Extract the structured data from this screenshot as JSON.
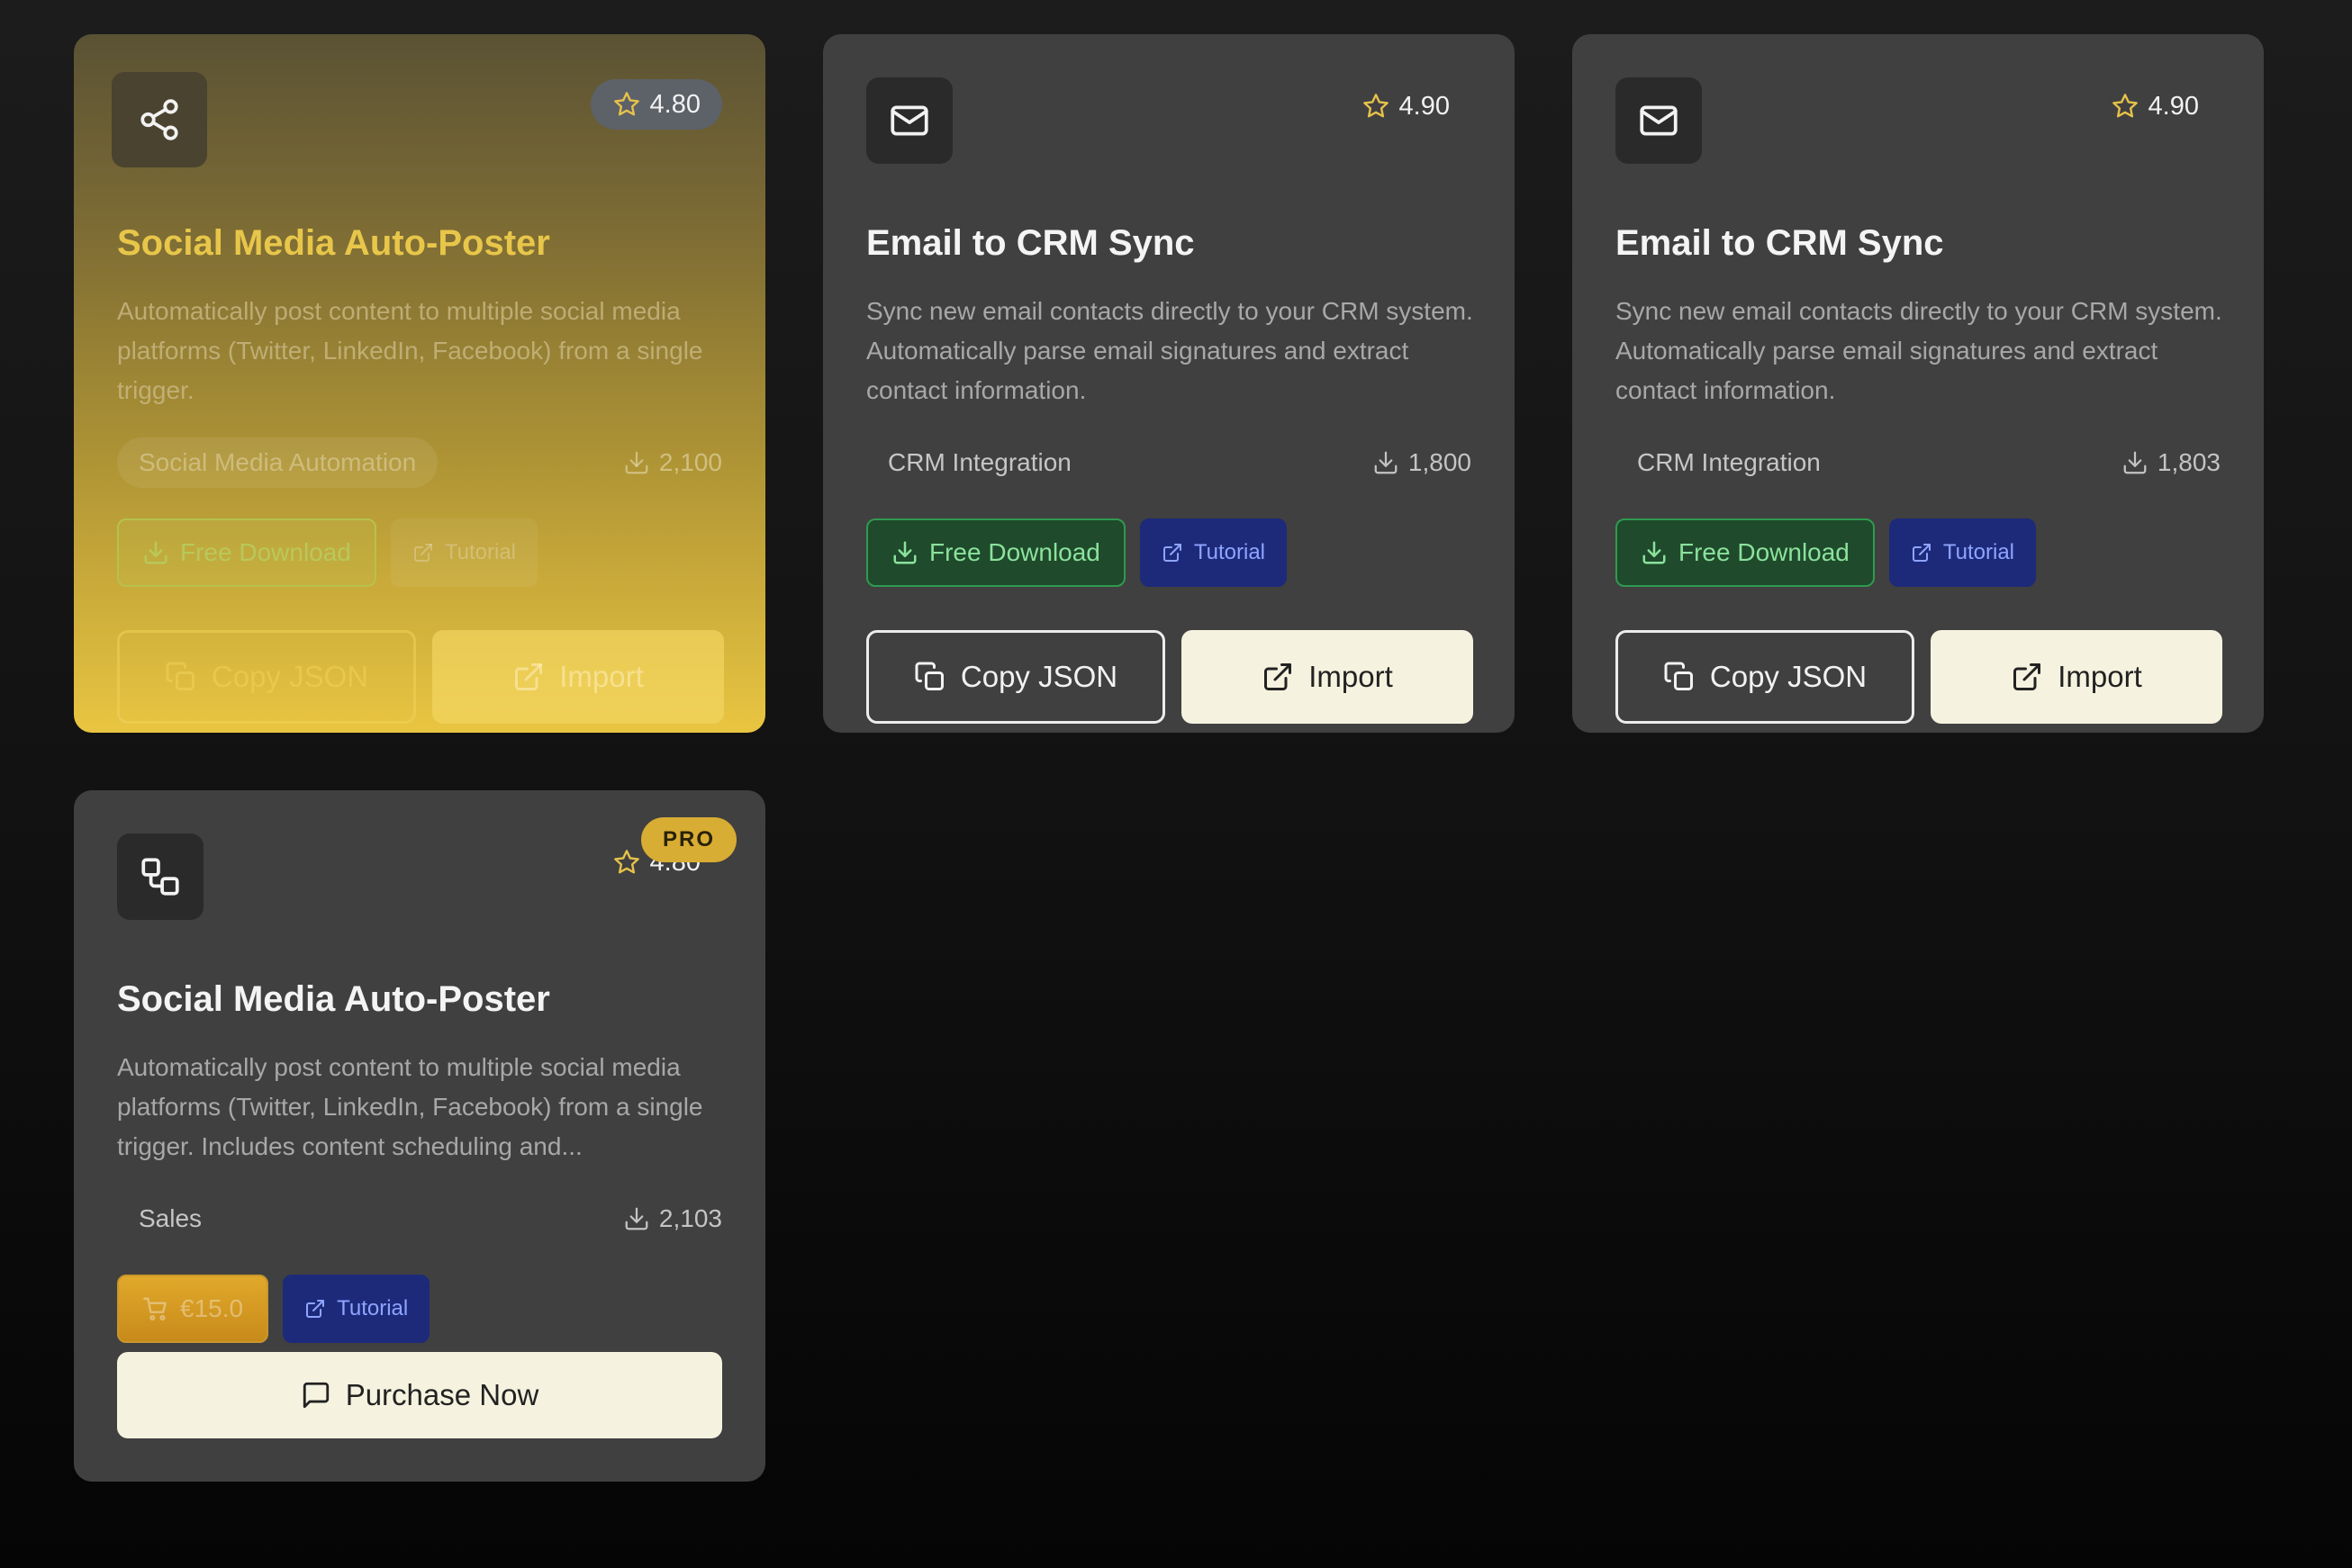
{
  "colors": {
    "page_background": "#111111",
    "card_background": "#404040",
    "featured_gold": "#e9c541",
    "download_green": "#2f9a4f",
    "tutorial_blue": "#1d2a7a",
    "import_cream": "#f5f3df",
    "pro_gold": "#d8ad33"
  },
  "cards": [
    {
      "icon": "share-icon",
      "rating": "4.80",
      "title": "Social Media Auto-Poster",
      "description": "Automatically post content to multiple social media platforms (Twitter, LinkedIn, Facebook) from a single trigger.",
      "category": "Social Media Automation",
      "downloads": "2,100",
      "free_download_label": "Free Download",
      "tutorial_label": "Tutorial",
      "copy_json_label": "Copy JSON",
      "import_label": "Import"
    },
    {
      "icon": "mail-icon",
      "rating": "4.90",
      "title": "Email to CRM Sync",
      "description": "Sync new email contacts directly to your CRM system. Automatically parse email signatures and extract contact information.",
      "category": "CRM Integration",
      "downloads": "1,800",
      "free_download_label": "Free Download",
      "tutorial_label": "Tutorial",
      "copy_json_label": "Copy JSON",
      "import_label": "Import"
    },
    {
      "icon": "mail-icon",
      "rating": "4.90",
      "title": "Email to CRM Sync",
      "description": "Sync new email contacts directly to your CRM system. Automatically parse email signatures and extract contact information.",
      "category": "CRM Integration",
      "downloads": "1,803",
      "free_download_label": "Free Download",
      "tutorial_label": "Tutorial",
      "copy_json_label": "Copy JSON",
      "import_label": "Import"
    },
    {
      "icon": "workflow-icon",
      "rating": "4.80",
      "badge": "PRO",
      "title": "Social Media Auto-Poster",
      "description": "Automatically post content to multiple social media platforms (Twitter, LinkedIn, Facebook) from a single trigger. Includes content scheduling and...",
      "category": "Sales",
      "downloads": "2,103",
      "price_label": "€15.0",
      "tutorial_label": "Tutorial",
      "purchase_label": "Purchase Now"
    }
  ]
}
